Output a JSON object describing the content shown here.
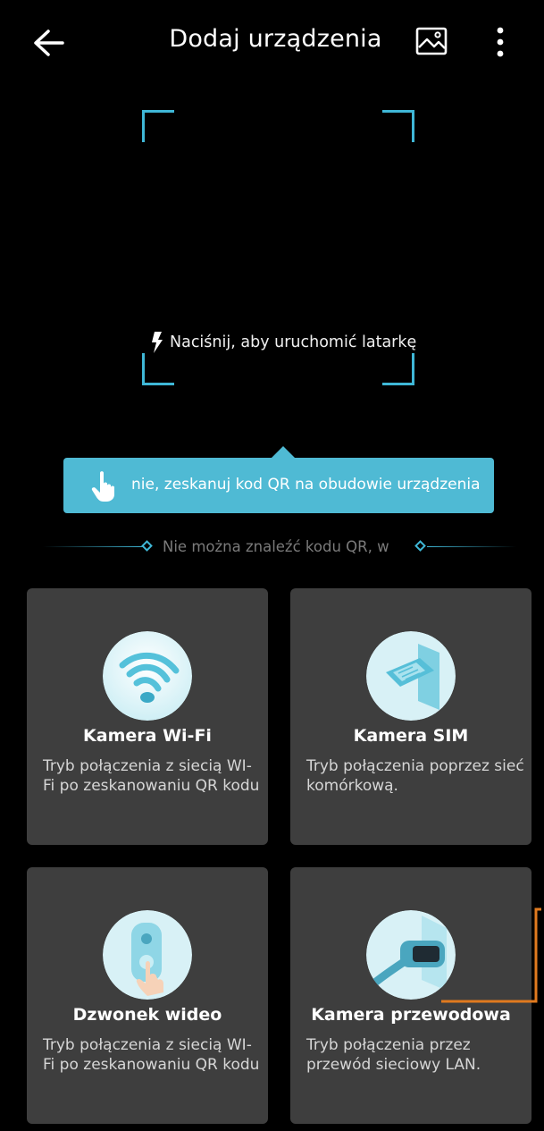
{
  "header": {
    "title": "Dodaj urządzenia",
    "back_icon": "arrow-left-icon",
    "gallery_icon": "image-icon",
    "more_icon": "more-vertical-icon"
  },
  "scanner": {
    "torch_label": "Naciśnij, aby uruchomić latarkę",
    "torch_icon": "flash-icon",
    "frame_color": "#3fb7d6"
  },
  "tooltip": {
    "text": "nie, zeskanuj kod QR na obudowie urządzenia",
    "icon": "hand-tap-icon",
    "color": "#4fbad4"
  },
  "hint": {
    "text": "Nie można znaleźć kodu QR, w"
  },
  "cards": [
    {
      "title": "Kamera Wi-Fi",
      "description": "Tryb połączenia z siecią WI-Fi po zeskanowaniu QR kodu",
      "icon": "wifi-icon"
    },
    {
      "title": "Kamera SIM",
      "description": "Tryb połączenia poprzez sieć komórkową.",
      "icon": "sim-card-icon"
    },
    {
      "title": "Dzwonek wideo",
      "description": "Tryb połączenia z siecią WI-Fi po zeskanowaniu QR kodu",
      "icon": "doorbell-icon"
    },
    {
      "title": "Kamera przewodowa",
      "description": "Tryb połączenia przez przewód sieciowy LAN.",
      "icon": "ethernet-cable-icon"
    }
  ],
  "colors": {
    "background": "#000000",
    "card": "#3e3e3e",
    "accent": "#3fb7d6",
    "annotation": "#e07a1f"
  }
}
